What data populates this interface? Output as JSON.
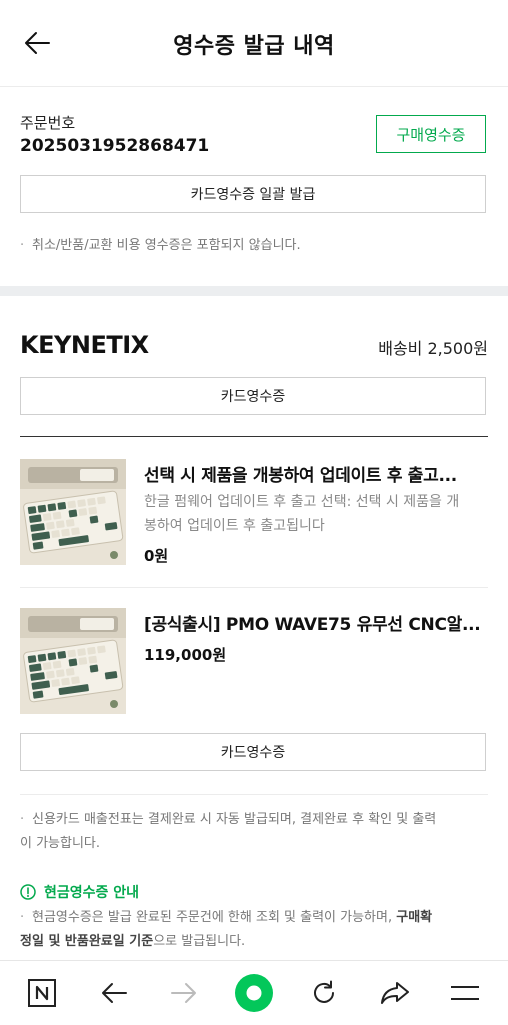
{
  "header": {
    "title": "영수증 발급 내역"
  },
  "order": {
    "label": "주문번호",
    "number": "2025031952868471",
    "purchase_receipt_button": "구매영수증",
    "bulk_card_receipt_button": "카드영수증 일괄 발급",
    "note": "취소/반품/교환 비용 영수증은 포함되지 않습니다."
  },
  "store": {
    "name": "KEYNETIX",
    "shipping": "배송비 2,500원",
    "card_receipt_button": "카드영수증",
    "card_receipt_button_bottom": "카드영수증"
  },
  "products": [
    {
      "name": "선택 시 제품을 개봉하여 업데이트 후 출고...",
      "option_line1": "한글 펌웨어 업데이트 후 출고 선택: 선택 시 제품을 개",
      "option_line2": "봉하여 업데이트 후 출고됩니다",
      "price": "0원",
      "thumb_icon": "keyboard-image"
    },
    {
      "name": "[공식출시] PMO WAVE75 유무선 CNC알...",
      "price": "119,000원",
      "thumb_icon": "keyboard-image"
    }
  ],
  "notes": {
    "credit_line1": "신용카드 매출전표는 결제완료 시 자동 발급되며, 결제완료 후 확인 및 출력",
    "credit_line2": "이 가능합니다.",
    "cash_title": "현금영수증 안내",
    "cash_line1_a": "현금영수증은 발급 완료된 주문건에 한해 조회 및 출력이 가능하며, ",
    "cash_line1_b": "구매확",
    "cash_line2_a": "정일 및 반품완료일 기준",
    "cash_line2_b": "으로 발급됩니다."
  },
  "bottom_nav": {
    "items": [
      "naver-logo-icon",
      "back-arrow-icon",
      "forward-arrow-icon",
      "home-circle-icon",
      "refresh-icon",
      "share-icon",
      "menu-icon"
    ]
  },
  "colors": {
    "accent": "#03a94d",
    "band": "#eceef0"
  }
}
